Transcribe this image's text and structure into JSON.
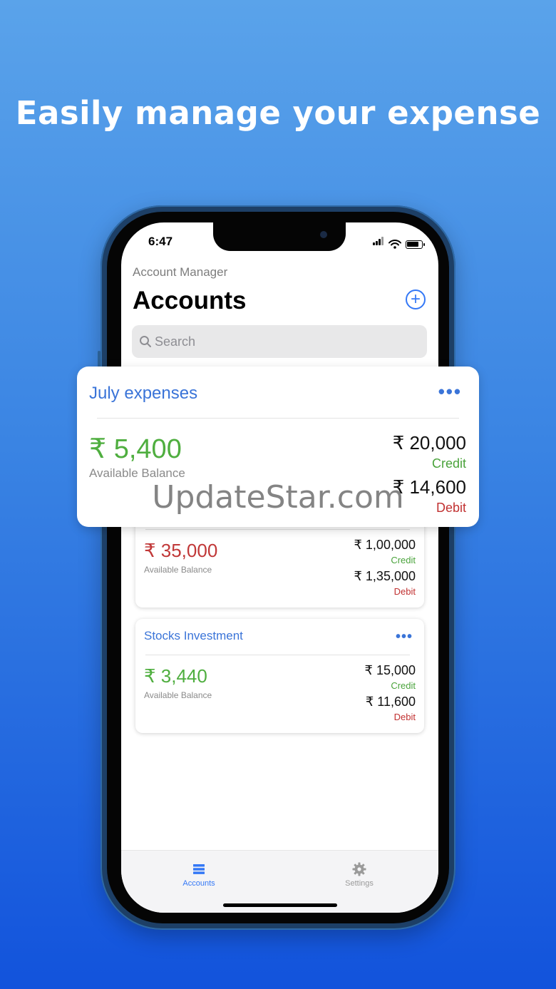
{
  "headline": "Easily manage your expense",
  "status_bar": {
    "time": "6:47"
  },
  "app": {
    "subtitle": "Account Manager",
    "title": "Accounts",
    "add_icon": "plus-circle-icon",
    "search_placeholder": "Search"
  },
  "featured_card": {
    "name": "July expenses",
    "more_icon": "ellipsis-icon",
    "balance": "₹ 5,400",
    "balance_label": "Available Balance",
    "credit_amount": "₹ 20,000",
    "credit_label": "Credit",
    "debit_amount": "₹ 14,600",
    "debit_label": "Debit"
  },
  "cards": [
    {
      "balance": "₹ 35,000",
      "balance_label": "Available Balance",
      "credit_amount": "₹ 1,00,000",
      "credit_label": "Credit",
      "debit_amount": "₹ 1,35,000",
      "debit_label": "Debit"
    },
    {
      "name": "Stocks Investment",
      "balance": "₹ 3,440",
      "balance_label": "Available Balance",
      "credit_amount": "₹ 15,000",
      "credit_label": "Credit",
      "debit_amount": "₹ 11,600",
      "debit_label": "Debit"
    }
  ],
  "tabbar": {
    "tabs": [
      {
        "label": "Accounts",
        "icon": "list-icon",
        "active": true
      },
      {
        "label": "Settings",
        "icon": "gear-icon",
        "active": false
      }
    ]
  },
  "watermark": "UpdateStar.com",
  "colors": {
    "accent": "#3478f6",
    "credit": "#4aa33b",
    "debit": "#c13131",
    "positive_balance": "#4fae3f",
    "negative_balance": "#c13838"
  }
}
